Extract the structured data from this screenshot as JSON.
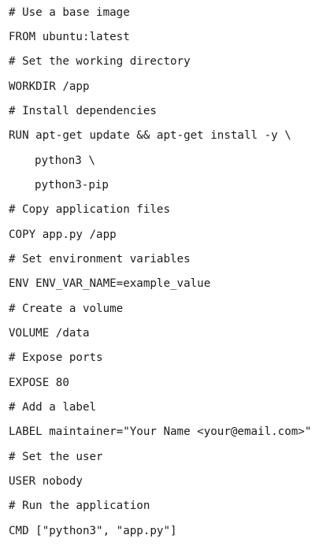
{
  "lines": [
    "# Use a base image",
    "FROM ubuntu:latest",
    "# Set the working directory",
    "WORKDIR /app",
    "# Install dependencies",
    "RUN apt-get update && apt-get install -y \\",
    "python3 \\",
    "python3-pip",
    "# Copy application files",
    "COPY app.py /app",
    "# Set environment variables",
    "ENV ENV_VAR_NAME=example_value",
    "# Create a volume",
    "VOLUME /data",
    "# Expose ports",
    "EXPOSE 80",
    "# Add a label",
    "LABEL maintainer=\"Your Name <your@email.com>\"",
    "# Set the user",
    "USER nobody",
    "# Run the application",
    "CMD [\"python3\", \"app.py\"]"
  ]
}
